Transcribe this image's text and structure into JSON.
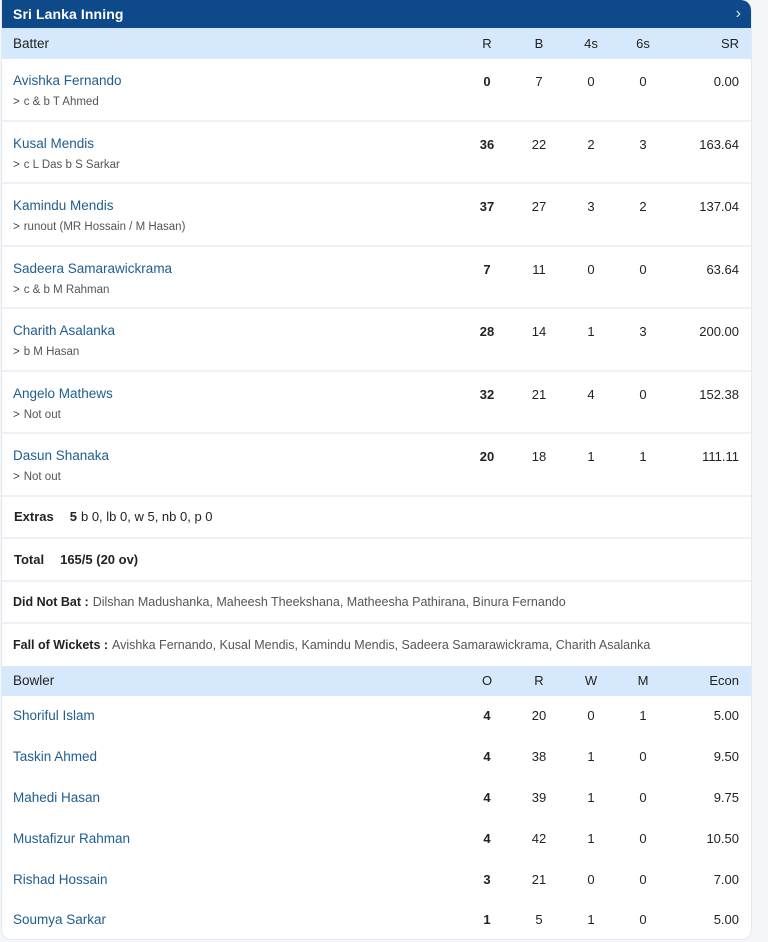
{
  "header": {
    "title": "Sri Lanka Inning",
    "chevron_icon": "chevron-right-icon"
  },
  "batting": {
    "columns": [
      "Batter",
      "R",
      "B",
      "4s",
      "6s",
      "SR"
    ],
    "rows": [
      {
        "name": "Avishka Fernando",
        "dismissal": "c & b T Ahmed",
        "r": "0",
        "b": "7",
        "fours": "0",
        "sixes": "0",
        "sr": "0.00"
      },
      {
        "name": "Kusal Mendis",
        "dismissal": "c L Das b S Sarkar",
        "r": "36",
        "b": "22",
        "fours": "2",
        "sixes": "3",
        "sr": "163.64"
      },
      {
        "name": "Kamindu Mendis",
        "dismissal": "runout (MR Hossain / M Hasan)",
        "r": "37",
        "b": "27",
        "fours": "3",
        "sixes": "2",
        "sr": "137.04"
      },
      {
        "name": "Sadeera Samarawickrama",
        "dismissal": "c & b M Rahman",
        "r": "7",
        "b": "11",
        "fours": "0",
        "sixes": "0",
        "sr": "63.64"
      },
      {
        "name": "Charith Asalanka",
        "dismissal": "b M Hasan",
        "r": "28",
        "b": "14",
        "fours": "1",
        "sixes": "3",
        "sr": "200.00"
      },
      {
        "name": "Angelo Mathews",
        "dismissal": "Not out",
        "r": "32",
        "b": "21",
        "fours": "4",
        "sixes": "0",
        "sr": "152.38"
      },
      {
        "name": "Dasun Shanaka",
        "dismissal": "Not out",
        "r": "20",
        "b": "18",
        "fours": "1",
        "sixes": "1",
        "sr": "111.11"
      }
    ],
    "dismissal_arrow": ">",
    "extras": {
      "label": "Extras",
      "total": "5",
      "detail": "b 0, lb 0, w 5, nb 0, p 0"
    },
    "total": {
      "label": "Total",
      "value": "165/5 (20 ov)"
    },
    "did_not_bat": {
      "label": "Did Not Bat :",
      "value": "Dilshan Madushanka, Maheesh Theekshana, Matheesha Pathirana, Binura Fernando"
    },
    "fall_of_wickets": {
      "label": "Fall of Wickets :",
      "value": "Avishka Fernando, Kusal Mendis, Kamindu Mendis, Sadeera Samarawickrama, Charith Asalanka"
    }
  },
  "bowling": {
    "columns": [
      "Bowler",
      "O",
      "R",
      "W",
      "M",
      "Econ"
    ],
    "rows": [
      {
        "name": "Shoriful Islam",
        "o": "4",
        "r": "20",
        "w": "0",
        "m": "1",
        "econ": "5.00"
      },
      {
        "name": "Taskin Ahmed",
        "o": "4",
        "r": "38",
        "w": "1",
        "m": "0",
        "econ": "9.50"
      },
      {
        "name": "Mahedi Hasan",
        "o": "4",
        "r": "39",
        "w": "1",
        "m": "0",
        "econ": "9.75"
      },
      {
        "name": "Mustafizur Rahman",
        "o": "4",
        "r": "42",
        "w": "1",
        "m": "0",
        "econ": "10.50"
      },
      {
        "name": "Rishad Hossain",
        "o": "3",
        "r": "21",
        "w": "0",
        "m": "0",
        "econ": "7.00"
      },
      {
        "name": "Soumya Sarkar",
        "o": "1",
        "r": "5",
        "w": "1",
        "m": "0",
        "econ": "5.00"
      }
    ]
  },
  "colors": {
    "header_bg": "#0e4a8a",
    "table_head_bg": "#d6e8fb",
    "player_link": "#1f5d8f"
  }
}
